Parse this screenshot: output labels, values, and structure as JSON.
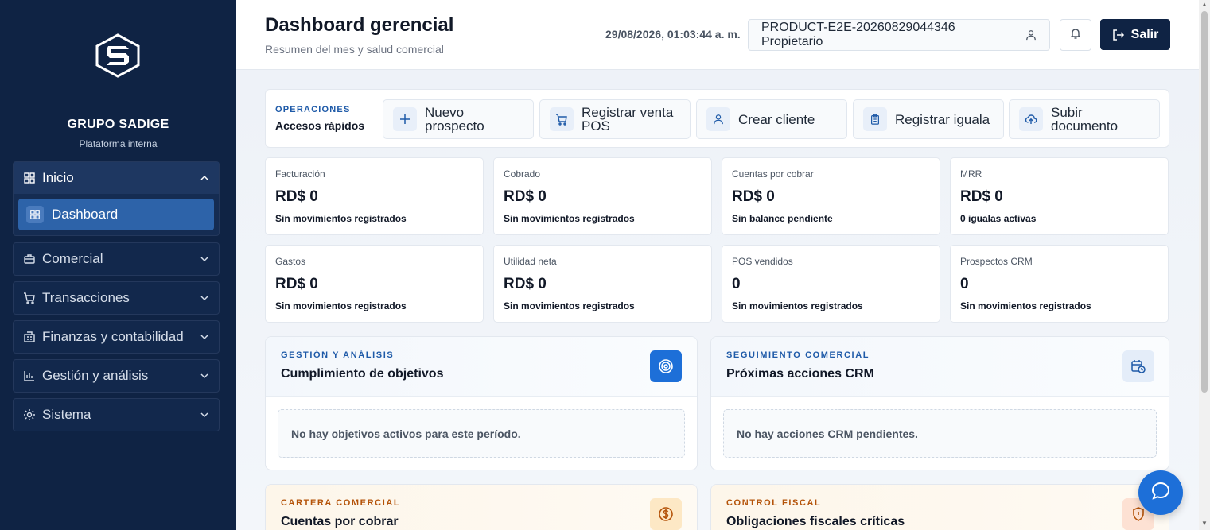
{
  "sidebar": {
    "brand": "GRUPO SADIGE",
    "subtitle": "Plataforma interna",
    "inicio": {
      "label": "Inicio",
      "icon": "grid-icon",
      "expanded": true
    },
    "dashboard": {
      "label": "Dashboard",
      "icon": "grid-icon",
      "active": true
    },
    "items": [
      {
        "label": "Comercial",
        "icon": "briefcase-icon"
      },
      {
        "label": "Transacciones",
        "icon": "cart-icon"
      },
      {
        "label": "Finanzas y contabilidad",
        "icon": "building-icon"
      },
      {
        "label": "Gestión y análisis",
        "icon": "bar-chart-icon"
      },
      {
        "label": "Sistema",
        "icon": "gear-icon"
      }
    ]
  },
  "header": {
    "title": "Dashboard gerencial",
    "subtitle": "Resumen del mes y salud comercial",
    "datetime": "29/08/2026, 01:03:44 a. m.",
    "user": "PRODUCT-E2E-20260829044346 Propietario",
    "logout_label": "Salir"
  },
  "quick": {
    "kicker": "OPERACIONES",
    "title": "Accesos rápidos",
    "actions": [
      {
        "label": "Nuevo prospecto",
        "icon": "plus-icon"
      },
      {
        "label": "Registrar venta POS",
        "icon": "cart-icon"
      },
      {
        "label": "Crear cliente",
        "icon": "user-icon"
      },
      {
        "label": "Registrar iguala",
        "icon": "clipboard-icon"
      },
      {
        "label": "Subir documento",
        "icon": "cloud-upload-icon"
      }
    ]
  },
  "kpis": [
    {
      "label": "Facturación",
      "value": "RD$ 0",
      "note": "Sin movimientos registrados"
    },
    {
      "label": "Cobrado",
      "value": "RD$ 0",
      "note": "Sin movimientos registrados"
    },
    {
      "label": "Cuentas por cobrar",
      "value": "RD$ 0",
      "note": "Sin balance pendiente"
    },
    {
      "label": "MRR",
      "value": "RD$ 0",
      "note": "0 igualas activas"
    },
    {
      "label": "Gastos",
      "value": "RD$ 0",
      "note": "Sin movimientos registrados"
    },
    {
      "label": "Utilidad neta",
      "value": "RD$ 0",
      "note": "Sin movimientos registrados"
    },
    {
      "label": "POS vendidos",
      "value": "0",
      "note": "Sin movimientos registrados"
    },
    {
      "label": "Prospectos CRM",
      "value": "0",
      "note": "Sin movimientos registrados"
    }
  ],
  "panels": {
    "objetivos": {
      "kicker": "GESTIÓN Y ANÁLISIS",
      "title": "Cumplimiento de objetivos",
      "empty": "No hay objetivos activos para este período.",
      "icon": "target-icon"
    },
    "crm": {
      "kicker": "SEGUIMIENTO COMERCIAL",
      "title": "Próximas acciones CRM",
      "empty": "No hay acciones CRM pendientes.",
      "icon": "calendar-clock-icon"
    },
    "cartera": {
      "kicker": "CARTERA COMERCIAL",
      "title": "Cuentas por cobrar",
      "icon": "dollar-circle-icon"
    },
    "fiscal": {
      "kicker": "CONTROL FISCAL",
      "title": "Obligaciones fiscales críticas",
      "icon": "shield-alert-icon"
    }
  },
  "colors": {
    "sidebar": "#0f2344",
    "accent": "#1d6fd8",
    "active_nav": "#2d63a9",
    "warm": "#b45309"
  }
}
